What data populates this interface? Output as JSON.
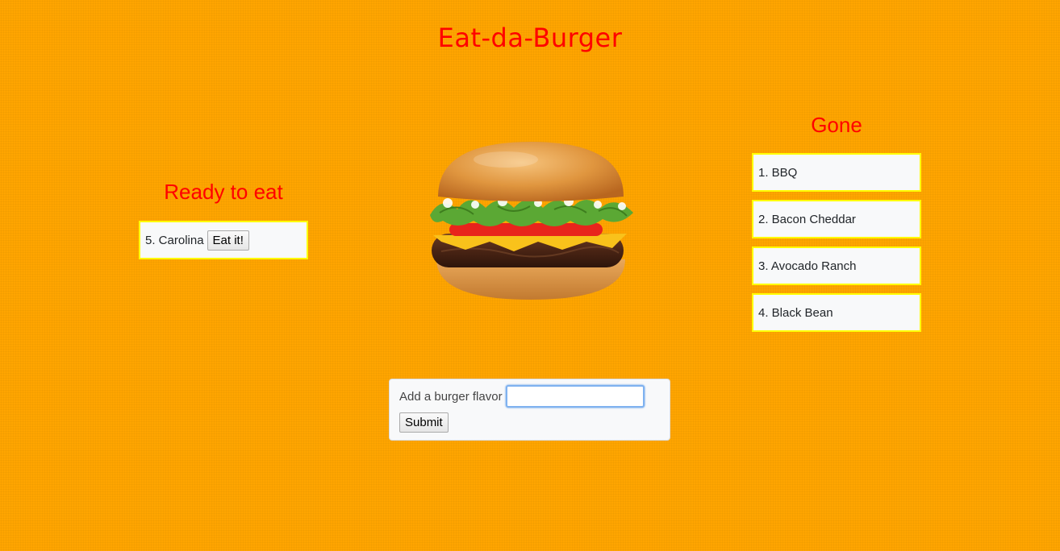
{
  "header": {
    "title": "Eat-da-Burger"
  },
  "ready": {
    "heading": "Ready to eat",
    "items": [
      {
        "label": "5. Carolina",
        "button_label": "Eat it!"
      }
    ]
  },
  "gone": {
    "heading": "Gone",
    "items": [
      {
        "label": "1. BBQ"
      },
      {
        "label": "2. Bacon Cheddar"
      },
      {
        "label": "3. Avocado Ranch"
      },
      {
        "label": "4. Black Bean"
      }
    ]
  },
  "image": {
    "icon": "hamburger-illustration"
  },
  "form": {
    "label": "Add a burger flavor",
    "input_value": "",
    "submit_label": "Submit"
  },
  "colors": {
    "background": "#FFA500",
    "heading": "#FF0000",
    "card_border": "#FFFF00",
    "card_background": "#F8F9FA"
  }
}
